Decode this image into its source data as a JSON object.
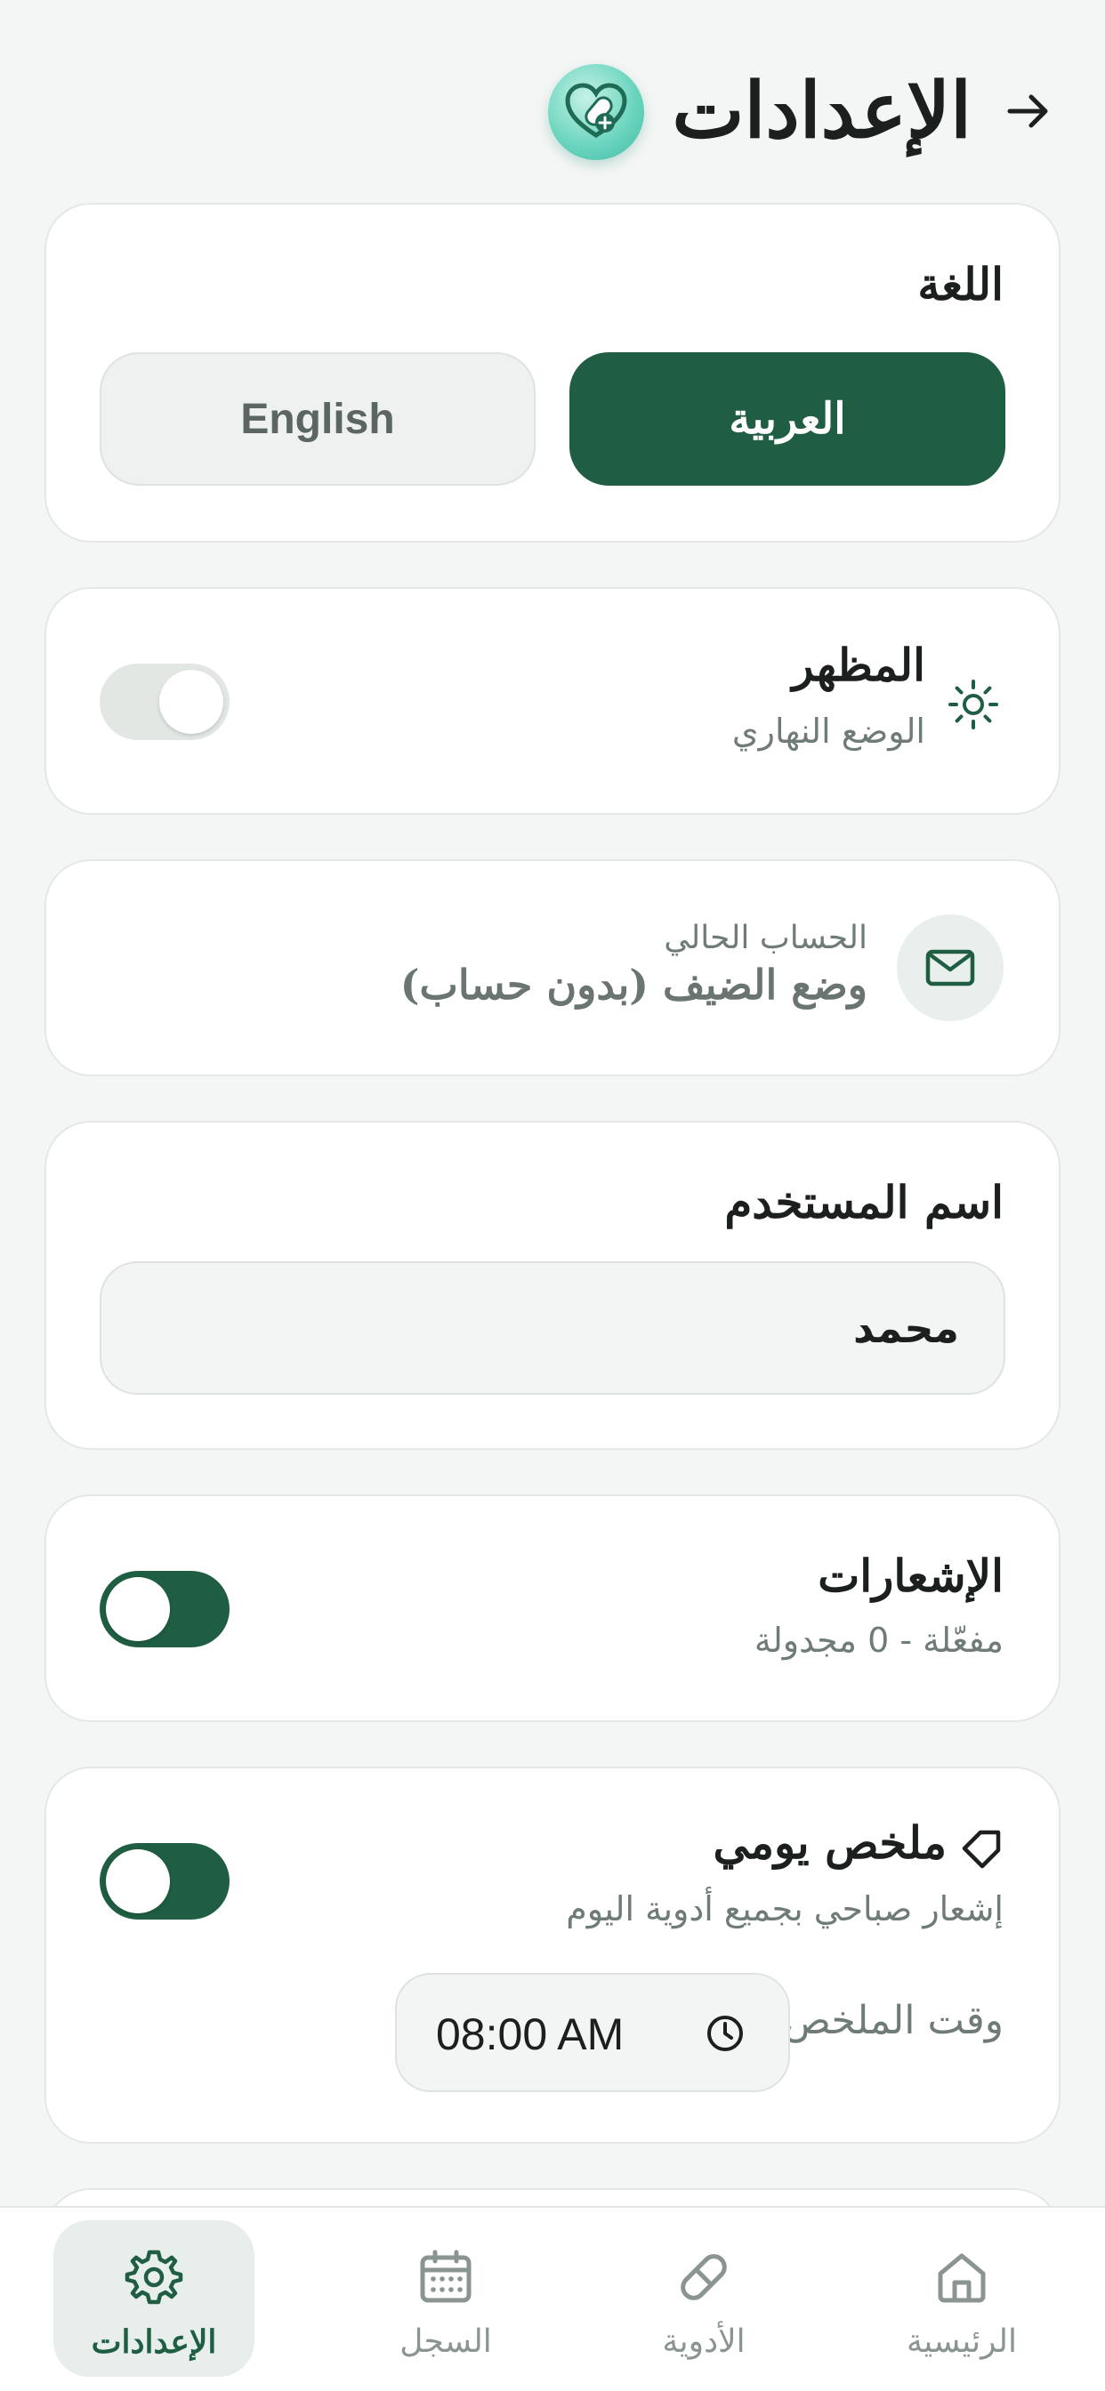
{
  "header": {
    "title": "الإعدادات",
    "back_icon": "arrow-right-icon",
    "logo_icon": "heart-pill-logo"
  },
  "language": {
    "title": "اللغة",
    "arabic_label": "العربية",
    "english_label": "English",
    "selected": "العربية"
  },
  "appearance": {
    "title": "المظهر",
    "subtitle": "الوضع النهاري",
    "icon": "sun-icon",
    "dark_mode": false
  },
  "account": {
    "caption": "الحساب الحالي",
    "value": "وضع الضيف (بدون حساب)",
    "icon": "mail-icon"
  },
  "username": {
    "title": "اسم المستخدم",
    "value": "محمد"
  },
  "notifications": {
    "title": "الإشعارات",
    "subtitle": "مفعّلة - 0 مجدولة",
    "enabled": true
  },
  "daily_summary": {
    "title": "ملخص يومي",
    "subtitle": "إشعار صباحي بجميع أدوية اليوم",
    "time_label": "وقت الملخص",
    "time_value": "08:00 AM",
    "enabled": true,
    "icon": "tag-icon"
  },
  "bottom_nav": {
    "items": [
      {
        "label": "الرئيسية",
        "icon": "home-icon"
      },
      {
        "label": "الأدوية",
        "icon": "pill-icon"
      },
      {
        "label": "السجل",
        "icon": "calendar-icon"
      },
      {
        "label": "الإعدادات",
        "icon": "gear-icon"
      }
    ],
    "active": "الإعدادات"
  },
  "colors": {
    "primary": "#1f5e43",
    "background": "#f4f6f5",
    "card": "#ffffff",
    "muted_text": "#6f7b76"
  }
}
